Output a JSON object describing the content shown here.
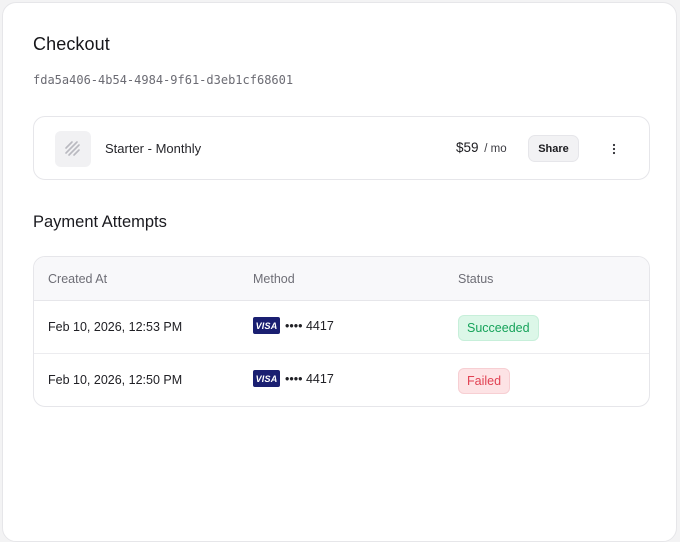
{
  "page": {
    "title": "Checkout",
    "checkout_id": "fda5a406-4b54-4984-9f61-d3eb1cf68601"
  },
  "product": {
    "icon": "image-placeholder-icon",
    "name": "Starter - Monthly",
    "price": "$59",
    "period": "/ mo",
    "share_label": "Share",
    "more_icon": "vertical-ellipsis-icon"
  },
  "payments": {
    "title": "Payment Attempts",
    "columns": [
      "Created At",
      "Method",
      "Status"
    ],
    "rows": [
      {
        "created_at": "Feb 10, 2026, 12:53 PM",
        "card_brand": "VISA",
        "card_number": "•••• 4417",
        "status": "Succeeded",
        "status_color": "#16a35a"
      },
      {
        "created_at": "Feb 10, 2026, 12:50 PM",
        "card_brand": "VISA",
        "card_number": "•••• 4417",
        "status": "Failed",
        "status_color": "#e14253"
      }
    ]
  },
  "colors": {
    "visa_blue": "#1a1f71",
    "success_bg": "#dcf7e8",
    "failed_bg": "#fde3e5"
  }
}
